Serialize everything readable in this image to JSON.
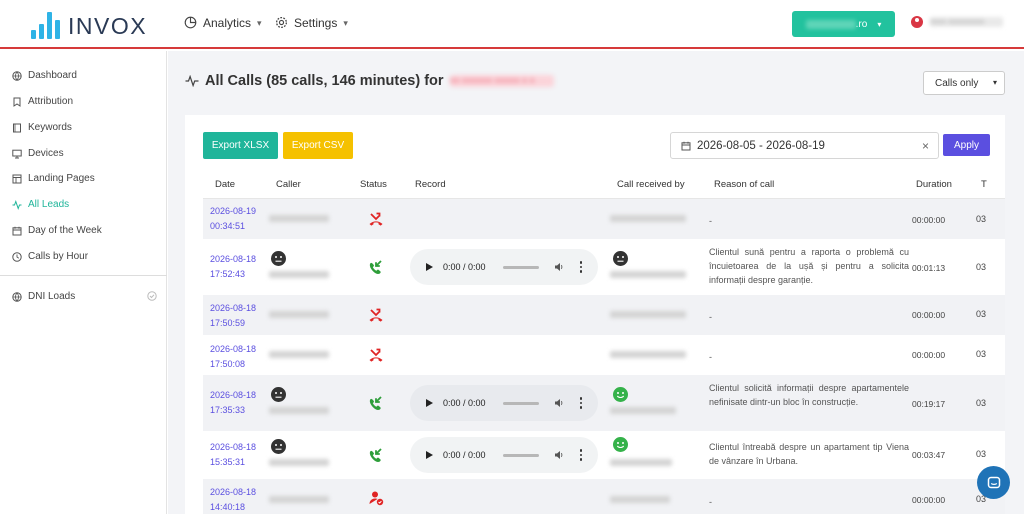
{
  "brand": {
    "name": "INVOX"
  },
  "nav": {
    "analytics": {
      "label": "Analytics",
      "icon": "pie-chart-icon"
    },
    "settings": {
      "label": "Settings",
      "icon": "gear-icon"
    }
  },
  "domain_button": {
    "suffix": ".ro",
    "hidden_text": "xxxxxxxxxx"
  },
  "user": {
    "name": "xxxx xxxxxxxxx"
  },
  "sidebar": {
    "items": [
      {
        "label": "Dashboard",
        "icon": "globe-icon",
        "active": false
      },
      {
        "label": "Attribution",
        "icon": "bookmark-icon",
        "active": false
      },
      {
        "label": "Keywords",
        "icon": "book-icon",
        "active": false
      },
      {
        "label": "Devices",
        "icon": "monitor-icon",
        "active": false
      },
      {
        "label": "Landing Pages",
        "icon": "layout-icon",
        "active": false
      },
      {
        "label": "All Leads",
        "icon": "activity-icon",
        "active": true
      },
      {
        "label": "Day of the Week",
        "icon": "calendar-icon",
        "active": false
      },
      {
        "label": "Calls by Hour",
        "icon": "clock-icon",
        "active": false
      }
    ],
    "dni": {
      "label": "DNI Loads",
      "icon": "globe-icon"
    }
  },
  "page": {
    "title": "All Calls (85 calls, 146 minutes) for",
    "title_hidden": "xx xxxxxx xxxxx x x",
    "filter_select": "Calls only",
    "export_xlsx": "Export XLSX",
    "export_csv": "Export CSV",
    "date_range": "2026-08-05 - 2026-08-19",
    "apply": "Apply",
    "colors": {
      "accent": "#1fb59a",
      "apply": "#5b4fe0",
      "csv": "#f5c100",
      "missed": "#e02424",
      "answered": "#2e9e3a"
    }
  },
  "table": {
    "headers": [
      "Date",
      "Caller",
      "Status",
      "Record",
      "Call received by",
      "Reason of call",
      "Duration",
      "T"
    ],
    "rows": [
      {
        "date": "2026-08-19",
        "time": "00:34:51",
        "status": "missed",
        "caller_face": "",
        "record": false,
        "record_time": "",
        "receiver_face": "",
        "reason": "-",
        "duration": "00:00:00",
        "t": "03"
      },
      {
        "date": "2026-08-18",
        "time": "17:52:43",
        "status": "answered",
        "caller_face": "neutral",
        "record": true,
        "record_time": "0:00 / 0:00",
        "receiver_face": "neutral",
        "reason": "Clientul sună pentru a raporta o problemă cu încuietoarea de la ușă și pentru a solicita informații despre garanție.",
        "duration": "00:01:13",
        "t": "03"
      },
      {
        "date": "2026-08-18",
        "time": "17:50:59",
        "status": "missed",
        "caller_face": "",
        "record": false,
        "record_time": "",
        "receiver_face": "",
        "reason": "-",
        "duration": "00:00:00",
        "t": "03"
      },
      {
        "date": "2026-08-18",
        "time": "17:50:08",
        "status": "missed",
        "caller_face": "",
        "record": false,
        "record_time": "",
        "receiver_face": "",
        "reason": "-",
        "duration": "00:00:00",
        "t": "03"
      },
      {
        "date": "2026-08-18",
        "time": "17:35:33",
        "status": "answered",
        "caller_face": "neutral",
        "record": true,
        "record_time": "0:00 / 0:00",
        "receiver_face": "happy",
        "reason": "Clientul solicită informații despre apartamentele nefinisate dintr-un bloc în construcție.",
        "duration": "00:19:17",
        "t": "03"
      },
      {
        "date": "2026-08-18",
        "time": "15:35:31",
        "status": "answered",
        "caller_face": "neutral",
        "record": true,
        "record_time": "0:00 / 0:00",
        "receiver_face": "happy",
        "reason": "Clientul întreabă despre un apartament tip Viena de vânzare în Urbana.",
        "duration": "00:03:47",
        "t": "03"
      },
      {
        "date": "2026-08-18",
        "time": "14:40:18",
        "status": "user",
        "caller_face": "",
        "record": false,
        "record_time": "",
        "receiver_face": "",
        "reason": "-",
        "duration": "00:00:00",
        "t": "03"
      }
    ]
  }
}
